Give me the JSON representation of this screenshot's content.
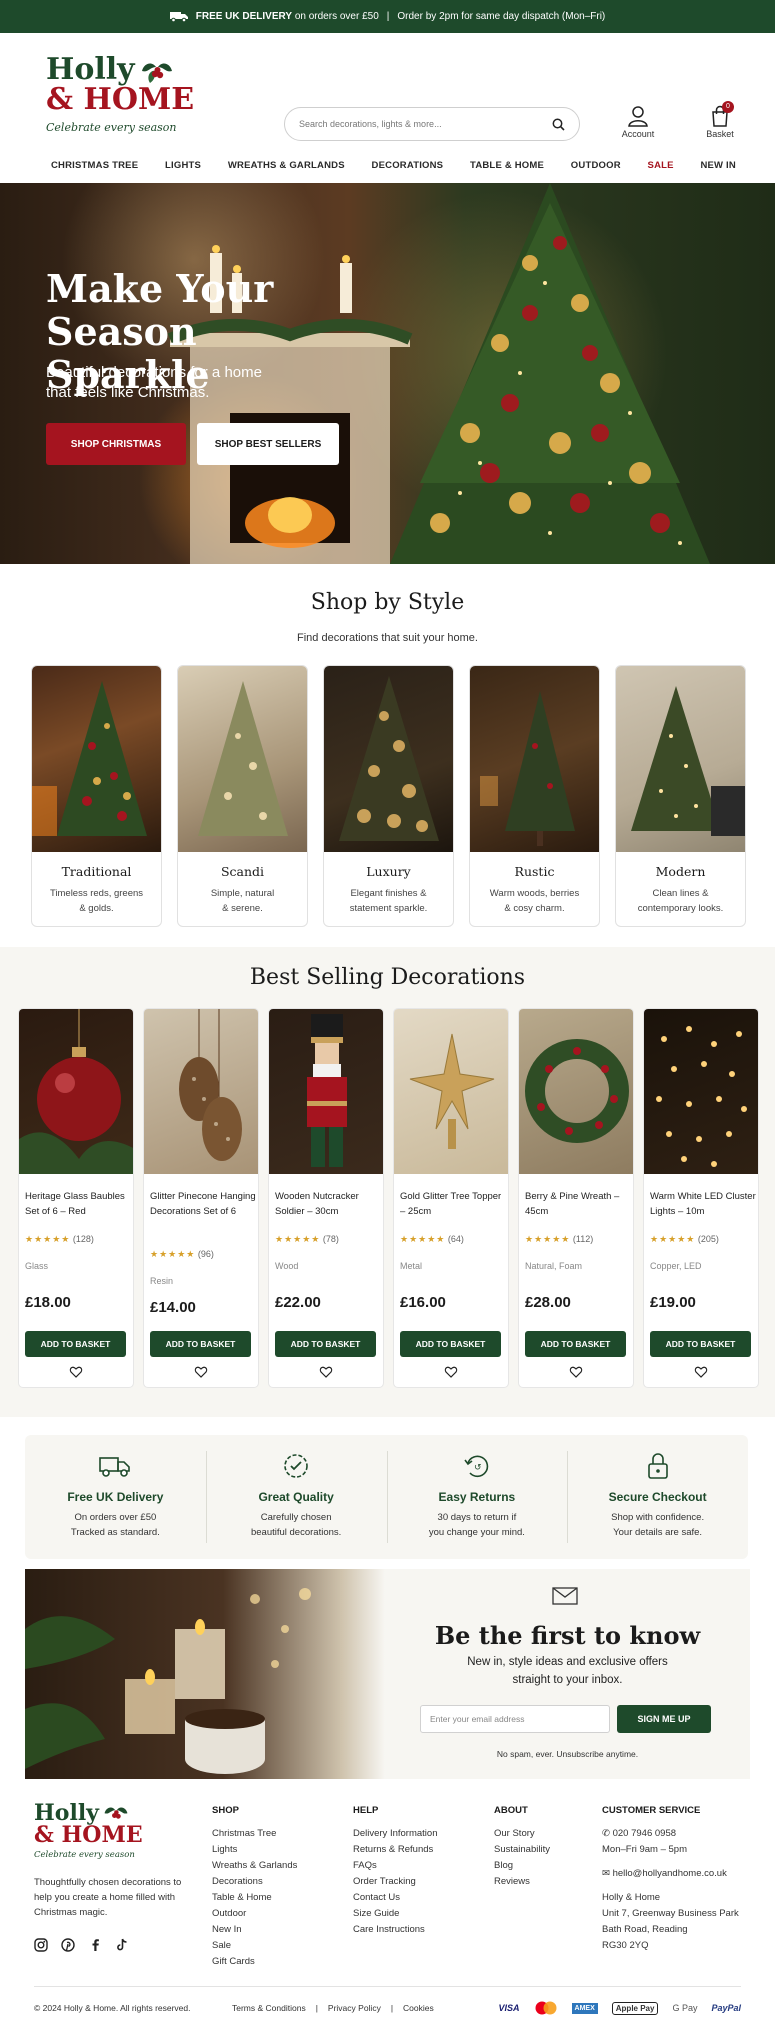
{
  "topbar": {
    "free_delivery": "FREE UK DELIVERY",
    "free_delivery_rest": "on orders over £50",
    "divider": "|",
    "dispatch": "Order by 2pm for same day dispatch (Mon–Fri)"
  },
  "brand": {
    "line1": "Holly",
    "line2": "& HOME",
    "tagline": "Celebrate every season",
    "green": "#1e4a2b",
    "red": "#a5141f"
  },
  "header": {
    "search_placeholder": "Search decorations, lights & more...",
    "account_label": "Account",
    "basket_label": "Basket",
    "basket_count": "0"
  },
  "nav": [
    "CHRISTMAS TREE",
    "LIGHTS",
    "WREATHS & GARLANDS",
    "DECORATIONS",
    "TABLE & HOME",
    "OUTDOOR",
    "SALE",
    "NEW IN"
  ],
  "hero": {
    "title_line1": "Make Your",
    "title_line2": "Season Sparkle",
    "subtitle": "Beautiful decorations for a home that feels like Christmas.",
    "primary_button": "SHOP CHRISTMAS",
    "secondary_button": "SHOP BEST SELLERS"
  },
  "shop_by_style": {
    "title": "Shop by Style",
    "subtitle": "Find decorations that suit your home.",
    "cards": [
      {
        "name": "Traditional",
        "desc1": "Timeless reds, greens",
        "desc2": "& golds."
      },
      {
        "name": "Scandi",
        "desc1": "Simple, natural",
        "desc2": "& serene."
      },
      {
        "name": "Luxury",
        "desc1": "Elegant finishes &",
        "desc2": "statement sparkle."
      },
      {
        "name": "Rustic",
        "desc1": "Warm woods, berries",
        "desc2": "& cosy charm."
      },
      {
        "name": "Modern",
        "desc1": "Clean lines &",
        "desc2": "contemporary looks."
      }
    ]
  },
  "best_selling": {
    "title": "Best Selling Decorations",
    "add_label": "ADD TO BASKET",
    "stars": "★★★★★",
    "products": [
      {
        "name": "Heritage Glass Baubles Set of 6 – Red",
        "reviews": "(128)",
        "material": "Glass",
        "price": "£18.00"
      },
      {
        "name": "Glitter Pinecone Hanging Decorations Set of 6",
        "reviews": "(96)",
        "material": "Resin",
        "price": "£14.00"
      },
      {
        "name": "Wooden Nutcracker Soldier – 30cm",
        "reviews": "(78)",
        "material": "Wood",
        "price": "£22.00"
      },
      {
        "name": "Gold Glitter Tree Topper – 25cm",
        "reviews": "(64)",
        "material": "Metal",
        "price": "£16.00"
      },
      {
        "name": "Berry & Pine Wreath – 45cm",
        "reviews": "(112)",
        "material": "Natural, Foam",
        "price": "£28.00"
      },
      {
        "name": "Warm White LED Cluster Lights – 10m",
        "reviews": "(205)",
        "material": "Copper, LED",
        "price": "£19.00"
      }
    ]
  },
  "features": [
    {
      "title": "Free UK Delivery",
      "line1": "On orders over £50",
      "line2": "Tracked as standard.",
      "icon": "truck-icon"
    },
    {
      "title": "Great Quality",
      "line1": "Carefully chosen",
      "line2": "beautiful decorations.",
      "icon": "quality-badge-icon"
    },
    {
      "title": "Easy Returns",
      "line1": "30 days to return if",
      "line2": "you change your mind.",
      "icon": "returns-icon"
    },
    {
      "title": "Secure Checkout",
      "line1": "Shop with confidence.",
      "line2": "Your details are safe.",
      "icon": "lock-icon"
    }
  ],
  "newsletter": {
    "title": "Be the first to know",
    "subtitle": "New in, style ideas and exclusive offers straight to your inbox.",
    "email_placeholder": "Enter your email address",
    "button": "SIGN ME UP",
    "note": "No spam, ever. Unsubscribe anytime."
  },
  "footer": {
    "about": "Thoughtfully chosen decorations to help you create a home filled with Christmas magic.",
    "columns": [
      {
        "title": "SHOP",
        "items": [
          "Christmas Tree",
          "Lights",
          "Wreaths & Garlands",
          "Decorations",
          "Table & Home",
          "Outdoor",
          "New In",
          "Sale",
          "Gift Cards"
        ]
      },
      {
        "title": "HELP",
        "items": [
          "Delivery Information",
          "Returns & Refunds",
          "FAQs",
          "Order Tracking",
          "Contact Us",
          "Size Guide",
          "Care Instructions"
        ]
      },
      {
        "title": "ABOUT",
        "items": [
          "Our Story",
          "Sustainability",
          "Blog",
          "Reviews"
        ]
      }
    ],
    "service": {
      "title": "CUSTOMER SERVICE",
      "phone": "020 7946 0958",
      "hours": "Mon–Fri 9am – 5pm",
      "email": "hello@hollyandhome.co.uk",
      "address": [
        "Holly & Home",
        "Unit 7, Greenway Business Park",
        "Bath Road, Reading",
        "RG30 2YQ"
      ]
    },
    "copyright": "© 2024 Holly & Home. All rights reserved.",
    "legal_links": [
      "Terms & Conditions",
      "Privacy Policy",
      "Cookies"
    ],
    "link_divider": "|",
    "payments": [
      "VISA",
      "Mastercard",
      "AMEX",
      "Apple Pay",
      "G Pay",
      "PayPal"
    ]
  }
}
